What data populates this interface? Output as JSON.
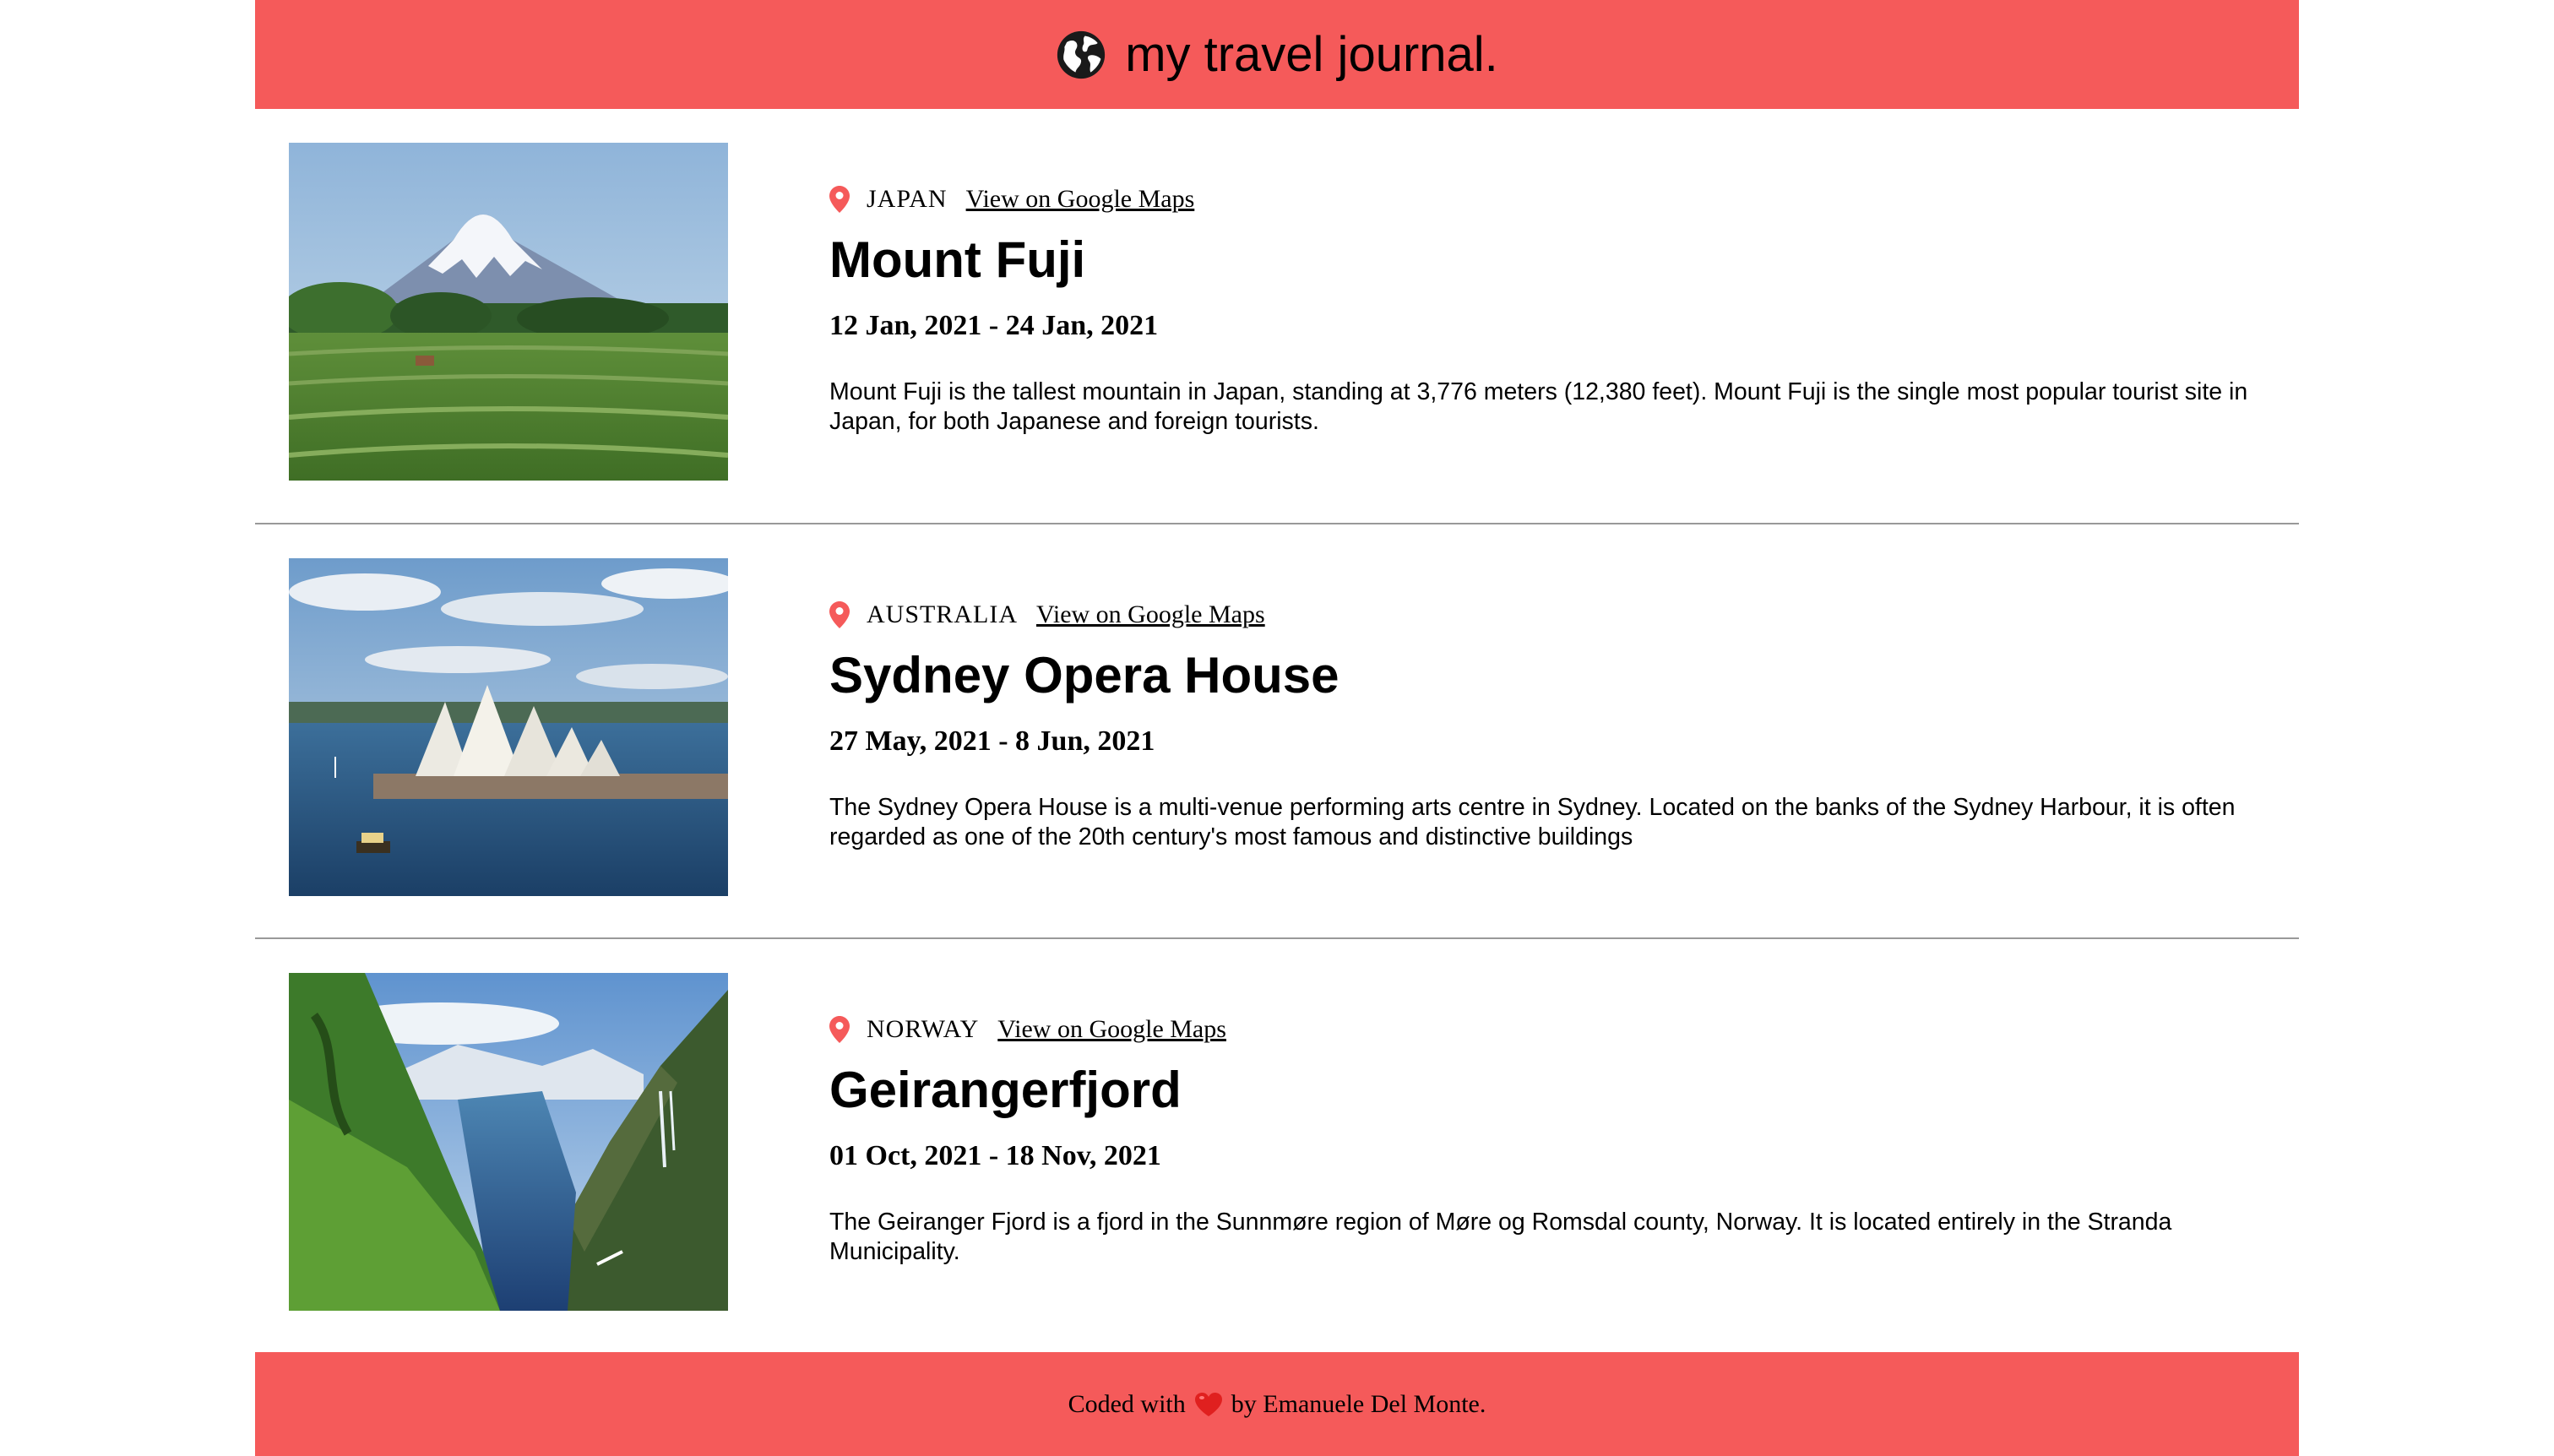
{
  "theme": {
    "accent_color": "#F55A5A",
    "divider_color": "#999999",
    "pin_color": "#F55A5A",
    "heart_color": "#E0201F"
  },
  "header": {
    "icon": "globe-icon",
    "title": "my travel journal."
  },
  "entries": [
    {
      "photo": "mount-fuji-photo",
      "location_icon": "map-pin-icon",
      "country": "JAPAN",
      "maps_link_label": "View on Google Maps",
      "title": "Mount Fuji",
      "dates": "12 Jan, 2021 - 24 Jan, 2021",
      "description": "Mount Fuji is the tallest mountain in Japan, standing at 3,776 meters (12,380 feet). Mount Fuji is the single most popular tourist site in Japan, for both Japanese and foreign tourists."
    },
    {
      "photo": "sydney-opera-house-photo",
      "location_icon": "map-pin-icon",
      "country": "AUSTRALIA",
      "maps_link_label": "View on Google Maps",
      "title": "Sydney Opera House",
      "dates": "27 May, 2021 - 8 Jun, 2021",
      "description": "The Sydney Opera House is a multi-venue performing arts centre in Sydney. Located on the banks of the Sydney Harbour, it is often regarded as one of the 20th century's most famous and distinctive buildings"
    },
    {
      "photo": "geirangerfjord-photo",
      "location_icon": "map-pin-icon",
      "country": "NORWAY",
      "maps_link_label": "View on Google Maps",
      "title": "Geirangerfjord",
      "dates": "01 Oct, 2021 - 18 Nov, 2021",
      "description": "The Geiranger Fjord is a fjord in the Sunnmøre region of Møre og Romsdal county, Norway. It is located entirely in the Stranda Municipality."
    }
  ],
  "footer": {
    "prefix": "Coded with",
    "icon": "heart-icon",
    "suffix": "by Emanuele Del Monte."
  }
}
